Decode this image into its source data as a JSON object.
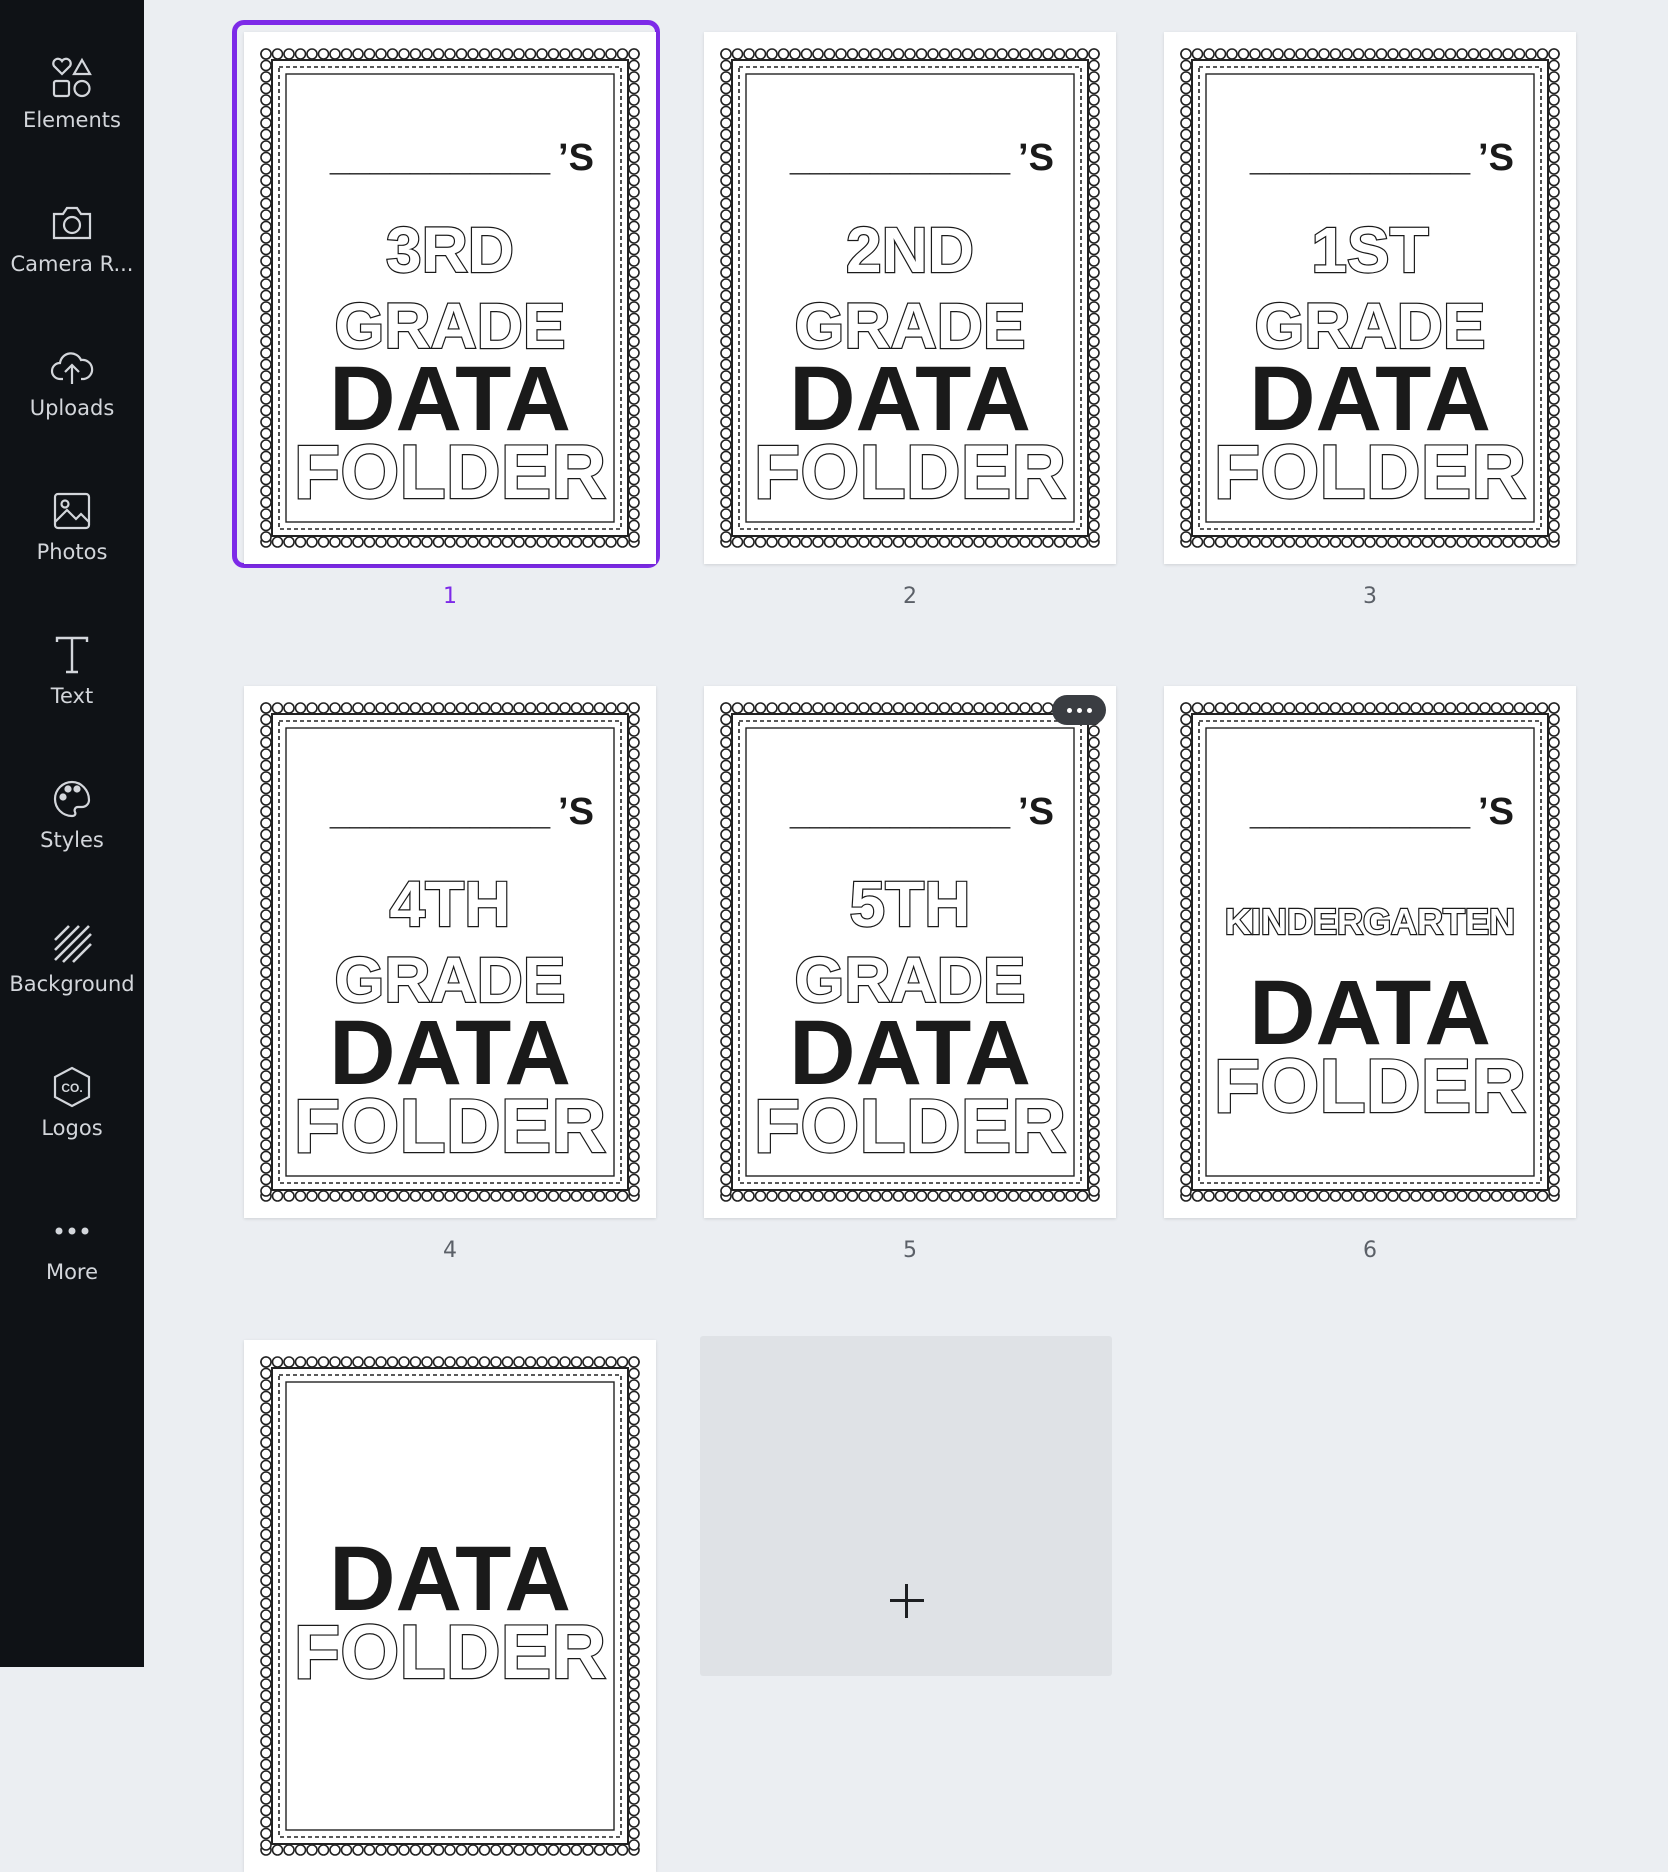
{
  "sidebar": {
    "items": [
      {
        "label": "Elements",
        "icon": "elements-icon"
      },
      {
        "label": "Camera R...",
        "icon": "camera-icon"
      },
      {
        "label": "Uploads",
        "icon": "cloud-upload-icon"
      },
      {
        "label": "Photos",
        "icon": "image-icon"
      },
      {
        "label": "Text",
        "icon": "text-icon"
      },
      {
        "label": "Styles",
        "icon": "palette-icon"
      },
      {
        "label": "Background",
        "icon": "stripes-icon"
      },
      {
        "label": "Logos",
        "icon": "logo-badge-icon"
      },
      {
        "label": "More",
        "icon": "more-dots-icon"
      }
    ]
  },
  "pages": [
    {
      "number": "1",
      "blank": "___________",
      "possessive": "’S",
      "grade_line1": "3RD",
      "grade_line2": "GRADE",
      "title1": "DATA",
      "title2": "FOLDER",
      "selected": true
    },
    {
      "number": "2",
      "blank": "___________",
      "possessive": "’S",
      "grade_line1": "2ND",
      "grade_line2": "GRADE",
      "title1": "DATA",
      "title2": "FOLDER"
    },
    {
      "number": "3",
      "blank": "___________",
      "possessive": "’S",
      "grade_line1": "1ST",
      "grade_line2": "GRADE",
      "title1": "DATA",
      "title2": "FOLDER"
    },
    {
      "number": "4",
      "blank": "___________",
      "possessive": "’S",
      "grade_line1": "4TH",
      "grade_line2": "GRADE",
      "title1": "DATA",
      "title2": "FOLDER"
    },
    {
      "number": "5",
      "blank": "___________",
      "possessive": "’S",
      "grade_line1": "5TH",
      "grade_line2": "GRADE",
      "title1": "DATA",
      "title2": "FOLDER"
    },
    {
      "number": "6",
      "blank": "___________",
      "possessive": "’S",
      "grade_line1": "KINDERGARTEN",
      "title1": "DATA",
      "title2": "FOLDER"
    },
    {
      "title1": "DATA",
      "title2": "FOLDER"
    }
  ],
  "colors": {
    "accent": "#7d2ae8",
    "sidebar_bg": "#0f1216",
    "canvas_bg": "#ebeef2"
  }
}
